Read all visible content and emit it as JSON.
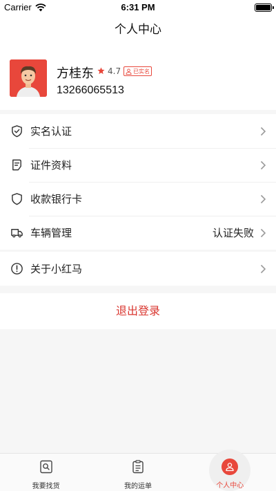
{
  "status_bar": {
    "carrier": "Carrier",
    "time": "6:31 PM",
    "battery_level": 1.0
  },
  "header": {
    "title": "个人中心"
  },
  "profile": {
    "name": "方桂东",
    "rating": "4.7",
    "badge": "已实名",
    "phone": "13266065513"
  },
  "menu_group_1": {
    "items": [
      {
        "label": "实名认证",
        "icon": "shield-check-icon"
      },
      {
        "label": "证件资料",
        "icon": "document-icon"
      },
      {
        "label": "收款银行卡",
        "icon": "shield-icon"
      },
      {
        "label": "车辆管理",
        "icon": "truck-icon",
        "value": "认证失败"
      }
    ]
  },
  "menu_group_2": {
    "items": [
      {
        "label": "关于小红马",
        "icon": "info-icon"
      }
    ]
  },
  "logout": {
    "label": "退出登录"
  },
  "tab_bar": {
    "tabs": [
      {
        "label": "我要找货",
        "icon": "find-goods-icon"
      },
      {
        "label": "我的运单",
        "icon": "clipboard-icon"
      },
      {
        "label": "个人中心",
        "icon": "user-icon",
        "active": true
      }
    ]
  },
  "colors": {
    "accent": "#e8473b",
    "logout": "#d9362f",
    "background": "#f6f6f6"
  }
}
